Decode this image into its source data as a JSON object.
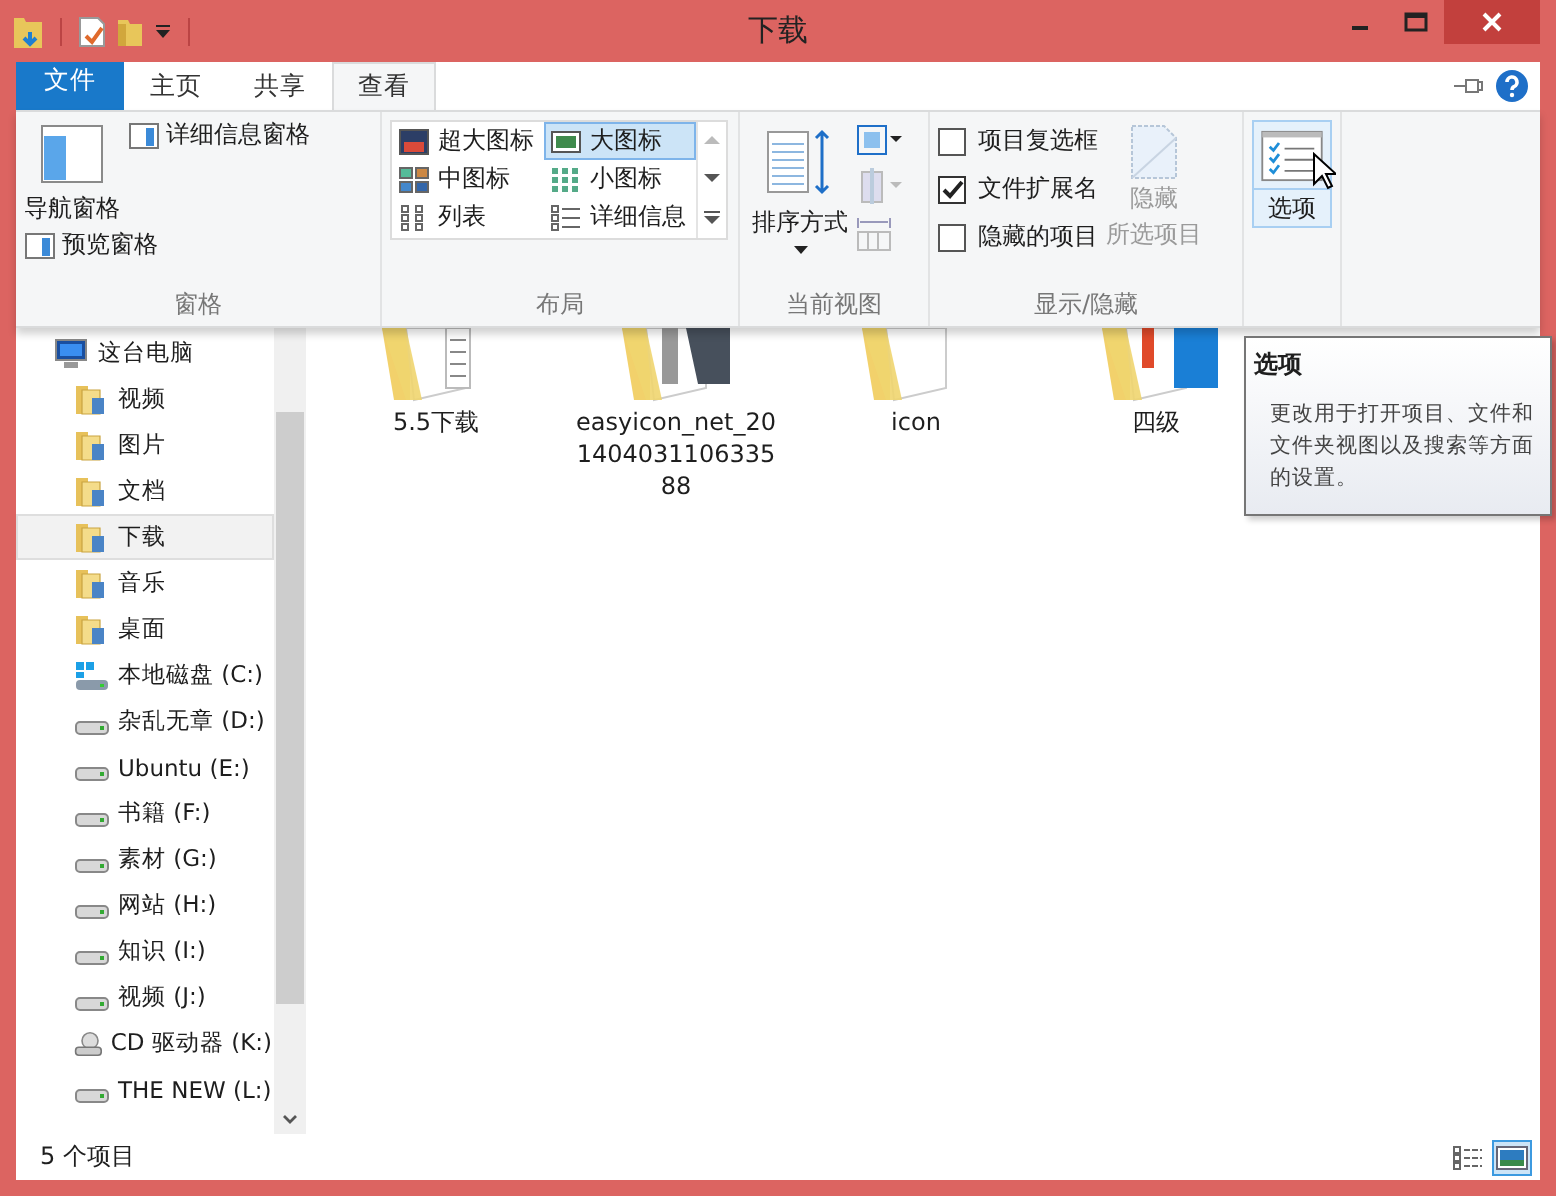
{
  "window": {
    "title": "下载"
  },
  "tabs": [
    {
      "label": "文件",
      "kind": "file",
      "selected": false
    },
    {
      "label": "主页",
      "kind": "tab",
      "selected": false
    },
    {
      "label": "共享",
      "kind": "tab",
      "selected": false
    },
    {
      "label": "查看",
      "kind": "tab",
      "selected": true
    }
  ],
  "ribbon": {
    "panes": {
      "label": "窗格",
      "nav_pane": "导航窗格",
      "preview_pane": "预览窗格",
      "details_pane": "详细信息窗格"
    },
    "layout": {
      "label": "布局",
      "items": [
        {
          "label": "超大图标",
          "kind": "xl",
          "selected": false
        },
        {
          "label": "大图标",
          "kind": "large",
          "selected": true
        },
        {
          "label": "中图标",
          "kind": "medium",
          "selected": false
        },
        {
          "label": "小图标",
          "kind": "small",
          "selected": false
        },
        {
          "label": "列表",
          "kind": "list",
          "selected": false
        },
        {
          "label": "详细信息",
          "kind": "details",
          "selected": false
        }
      ]
    },
    "current_view": {
      "label": "当前视图",
      "sort": "排序方式"
    },
    "show_hide": {
      "label": "显示/隐藏",
      "checkboxes": [
        {
          "label": "项目复选框",
          "checked": false
        },
        {
          "label": "文件扩展名",
          "checked": true
        },
        {
          "label": "隐藏的项目",
          "checked": false
        }
      ],
      "hide_selected": {
        "lines": [
          "隐藏",
          "所选项目"
        ],
        "disabled": true
      }
    },
    "options": {
      "label": "选项",
      "highlighted": true
    }
  },
  "nav": [
    {
      "label": "这台电脑",
      "kind": "computer",
      "selected": false,
      "children": [
        {
          "label": "视频",
          "kind": "folder",
          "selected": false
        },
        {
          "label": "图片",
          "kind": "folder",
          "selected": false
        },
        {
          "label": "文档",
          "kind": "folder",
          "selected": false
        },
        {
          "label": "下载",
          "kind": "folder",
          "selected": true
        },
        {
          "label": "音乐",
          "kind": "folder",
          "selected": false
        },
        {
          "label": "桌面",
          "kind": "folder",
          "selected": false
        },
        {
          "label": "本地磁盘 (C:)",
          "kind": "system",
          "selected": false
        },
        {
          "label": "杂乱无章 (D:)",
          "kind": "drive",
          "selected": false
        },
        {
          "label": "Ubuntu (E:)",
          "kind": "drive",
          "selected": false
        },
        {
          "label": "书籍 (F:)",
          "kind": "drive",
          "selected": false
        },
        {
          "label": "素材 (G:)",
          "kind": "drive",
          "selected": false
        },
        {
          "label": "网站 (H:)",
          "kind": "drive",
          "selected": false
        },
        {
          "label": "知识 (I:)",
          "kind": "drive",
          "selected": false
        },
        {
          "label": "视频 (J:)",
          "kind": "drive",
          "selected": false
        },
        {
          "label": "CD 驱动器 (K:)",
          "kind": "cd",
          "selected": false
        },
        {
          "label": "THE NEW (L:)",
          "kind": "drive",
          "selected": false
        }
      ]
    }
  ],
  "files": [
    {
      "name": "5.5下载",
      "kind": "doc"
    },
    {
      "name": "easyicon_net_20140403110633588",
      "kind": "dark"
    },
    {
      "name": "icon",
      "kind": "blank"
    },
    {
      "name": "四级",
      "kind": "blue"
    }
  ],
  "tooltip": {
    "title": "选项",
    "lines": [
      "更改用于打开项目、文件和",
      "文件夹视图以及搜索等方面",
      "的设置。"
    ]
  },
  "status_bar": {
    "count": "5 个项目",
    "views": [
      {
        "kind": "details",
        "selected": false
      },
      {
        "kind": "large",
        "selected": true
      }
    ]
  }
}
